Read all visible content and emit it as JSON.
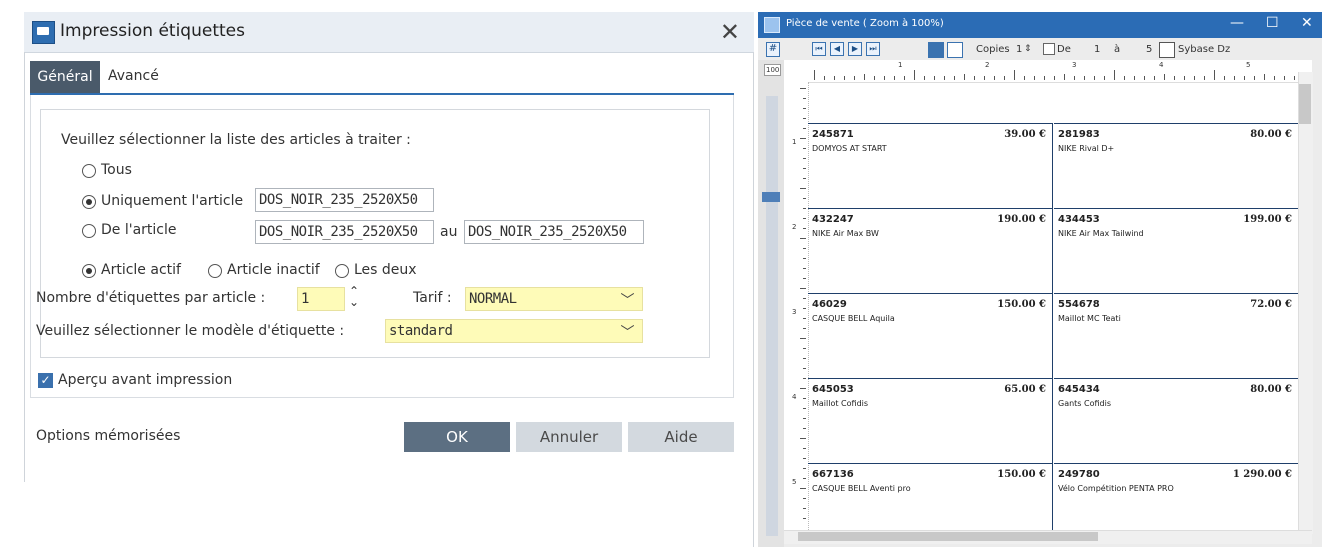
{
  "dialog": {
    "title": "Impression étiquettes",
    "close": "✕",
    "tabs": [
      "Général",
      "Avancé"
    ],
    "prompt": "Veuillez sélectionner la liste des articles à traiter :",
    "radio_all": "Tous",
    "radio_only": "Uniquement l'article",
    "only_value": "DOS_NOIR_235_2520X50",
    "radio_from": "De l'article",
    "from_value": "DOS_NOIR_235_2520X50",
    "to_label": "au",
    "to_value": "DOS_NOIR_235_2520X50",
    "status_active": "Article actif",
    "status_inactive": "Article inactif",
    "status_both": "Les deux",
    "labels_per_article_label": "Nombre d'étiquettes par article :",
    "labels_per_article_value": "1",
    "tarif_label": "Tarif :",
    "tarif_value": "NORMAL",
    "model_label": "Veuillez sélectionner le modèle d'étiquette :",
    "model_value": "standard",
    "preview_checkbox": "Aperçu avant impression",
    "saved_options": "Options mémorisées",
    "ok": "OK",
    "cancel": "Annuler",
    "help": "Aide"
  },
  "preview": {
    "title": "Pièce de vente ( Zoom à 100%)",
    "minimize": "—",
    "maximize": "☐",
    "close": "✕",
    "hash": "#",
    "zoom_level": "100",
    "copies_label": "Copies",
    "copies_value": "1",
    "from_label": "De",
    "range_from": "1",
    "range_sep": "à",
    "range_to": "5",
    "printer": "Sybase Dz",
    "nav": [
      "⏮",
      "◀",
      "▶",
      "⏭"
    ],
    "ruler_h": [
      "1",
      "2",
      "3",
      "4",
      "5"
    ],
    "ruler_v": [
      "1",
      "2",
      "3",
      "4",
      "5"
    ],
    "labels": [
      {
        "code": "245871",
        "price": "39.00 €",
        "name": "DOMYOS AT START"
      },
      {
        "code": "281983",
        "price": "80.00 €",
        "name": "NIKE Rival D+"
      },
      {
        "code": "432247",
        "price": "190.00 €",
        "name": "NIKE Air Max BW"
      },
      {
        "code": "434453",
        "price": "199.00 €",
        "name": "NIKE Air Max Tailwind"
      },
      {
        "code": "46029",
        "price": "150.00 €",
        "name": "CASQUE BELL Aquila"
      },
      {
        "code": "554678",
        "price": "72.00 €",
        "name": "Maillot MC Teati"
      },
      {
        "code": "645053",
        "price": "65.00 €",
        "name": "Maillot Cofidis"
      },
      {
        "code": "645434",
        "price": "80.00 €",
        "name": "Gants Cofidis"
      },
      {
        "code": "667136",
        "price": "150.00 €",
        "name": "CASQUE BELL Aventi pro"
      },
      {
        "code": "249780",
        "price": "1 290.00 €",
        "name": "Vélo Compétition PENTA PRO"
      }
    ]
  }
}
